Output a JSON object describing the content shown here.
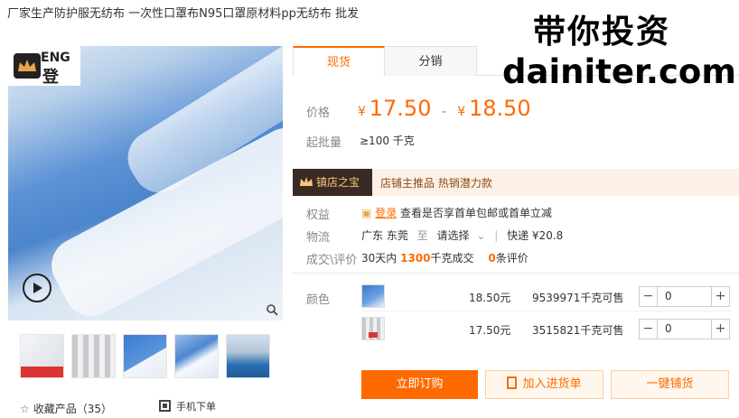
{
  "product": {
    "title": "厂家生产防护服无纺布 一次性口罩布N95口罩原材料pp无纺布 批发"
  },
  "gallery": {
    "logo_text": "ENG",
    "logo_cn": "登",
    "icons": {
      "play": "play-icon",
      "zoom": "zoom-icon"
    }
  },
  "tabs": [
    {
      "label": "现货"
    },
    {
      "label": "分销"
    }
  ],
  "price": {
    "label": "价格",
    "currency": "¥",
    "min": "17.50",
    "separator": "-",
    "max": "18.50"
  },
  "moq": {
    "label": "起批量",
    "value": "≥100 千克"
  },
  "banner": {
    "badge": "镇店之宝",
    "text": "店铺主推品  热销潜力款"
  },
  "rights": {
    "label": "权益",
    "login": "登录",
    "text": "查看是否享首单包邮或首单立减"
  },
  "logistics": {
    "label": "物流",
    "origin": "广东 东莞",
    "to": "至",
    "select": "请选择",
    "shipping": "快递 ¥20.8"
  },
  "transactions": {
    "label": "成交\\评价",
    "prefix": "30天内",
    "count": "1300",
    "unit": "千克成交",
    "reviews_count": "0",
    "reviews_label": "条评价"
  },
  "sku": {
    "label": "颜色",
    "rows": [
      {
        "price": "18.50元",
        "stock": "9539971千克可售",
        "qty": "0",
        "minus": "−",
        "plus": "+"
      },
      {
        "price": "17.50元",
        "stock": "3515821千克可售",
        "qty": "0",
        "minus": "−",
        "plus": "+"
      }
    ]
  },
  "actions": {
    "order": "立即订购",
    "cart": "加入进货单",
    "quick": "一键铺货"
  },
  "footer": {
    "favorite_label": "收藏产品（35）",
    "mobile_label": "手机下单"
  },
  "watermark": {
    "line1": "带你投资",
    "line2": "dainiter.com"
  },
  "colors": {
    "accent": "#ff6a00",
    "badge_bg": "#3a2a24",
    "banner_bg": "#fdf0e6"
  }
}
